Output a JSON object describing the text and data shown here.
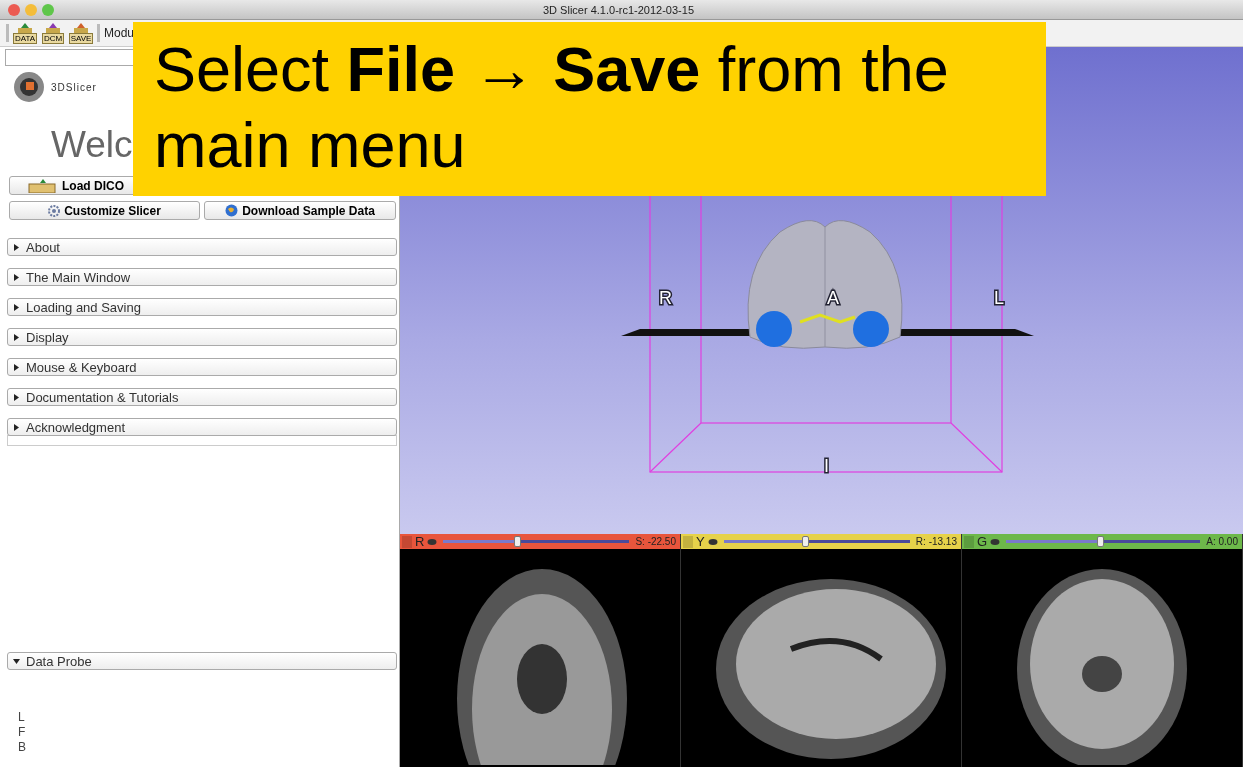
{
  "window": {
    "title": "3D Slicer 4.1.0-rc1-2012-03-15"
  },
  "toolbar": {
    "buttons": [
      {
        "label": "DATA",
        "kind": "load"
      },
      {
        "label": "DCM",
        "kind": "dicom"
      },
      {
        "label": "SAVE",
        "kind": "save"
      }
    ],
    "module_selector": "Modu"
  },
  "welcome": {
    "logo_text": "3DSlicer",
    "heading": "Welc",
    "buttons": [
      {
        "label": "Load DICO",
        "kind": "dicom"
      },
      {
        "kind": "blank"
      },
      {
        "label": "Customize Slicer",
        "kind": "gear"
      },
      {
        "label": "Download Sample Data",
        "kind": "globe"
      }
    ]
  },
  "sections": [
    {
      "label": "About",
      "expanded": false
    },
    {
      "label": "The Main Window",
      "expanded": false
    },
    {
      "label": "Loading and Saving",
      "expanded": false
    },
    {
      "label": "Display",
      "expanded": false
    },
    {
      "label": "Mouse & Keyboard",
      "expanded": false
    },
    {
      "label": "Documentation & Tutorials",
      "expanded": false
    },
    {
      "label": "Acknowledgment",
      "expanded": false
    }
  ],
  "data_probe": {
    "label": "Data Probe",
    "expanded": true,
    "labels": [
      "L",
      "F",
      "B"
    ]
  },
  "view3d": {
    "orientation_labels": [
      "R",
      "A",
      "L",
      "I"
    ]
  },
  "slice_views": [
    {
      "letter": "R",
      "color": "#e8553c",
      "level": 0.4,
      "reading": "S: -22.50"
    },
    {
      "letter": "Y",
      "color": "#e6d24a",
      "level": 0.44,
      "reading": "R: -13.13"
    },
    {
      "letter": "G",
      "color": "#6db84a",
      "level": 0.49,
      "reading": "A: 0.00"
    }
  ],
  "callout": {
    "text": "Select **File → Save** from the main menu"
  }
}
